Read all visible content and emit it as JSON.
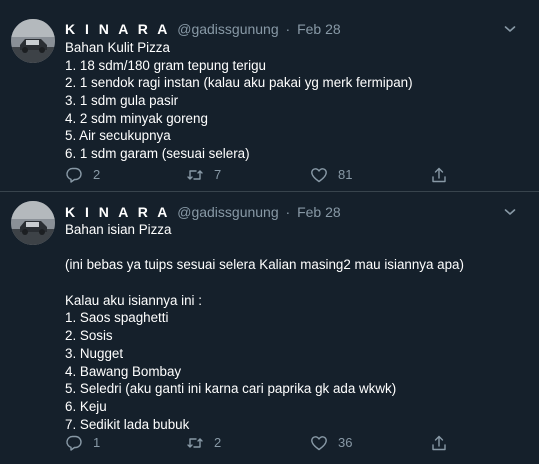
{
  "tweets": [
    {
      "display_name": "K I N A R A",
      "handle": "@gadissgunung",
      "separator": "·",
      "date": "Feb 28",
      "lines": [
        "Bahan Kulit Pizza",
        "1. 18 sdm/180 gram tepung terigu",
        "2. 1 sendok ragi instan (kalau aku pakai yg merk fermipan)",
        "3. 1 sdm gula pasir",
        "4. 2 sdm minyak goreng",
        "5. Air secukupnya",
        "6. 1 sdm garam (sesuai selera)"
      ],
      "reply_count": "2",
      "retweet_count": "7",
      "like_count": "81"
    },
    {
      "display_name": "K I N A R A",
      "handle": "@gadissgunung",
      "separator": "·",
      "date": "Feb 28",
      "lines": [
        "Bahan isian Pizza",
        "",
        "(ini bebas ya tuips sesuai selera Kalian masing2 mau isiannya apa)",
        "",
        "Kalau aku isiannya ini :",
        "1. Saos spaghetti",
        "2. Sosis",
        "3. Nugget",
        "4. Bawang Bombay",
        "5. Seledri (aku ganti ini karna cari paprika gk ada wkwk)",
        "6. Keju",
        "7. Sedikit lada bubuk"
      ],
      "reply_count": "1",
      "retweet_count": "2",
      "like_count": "36"
    }
  ],
  "icons": {
    "reply": "reply-icon",
    "retweet": "retweet-icon",
    "like": "heart-icon",
    "share": "share-icon",
    "caret": "chevron-down-icon"
  },
  "colors": {
    "background": "#15202b",
    "text": "#ffffff",
    "secondary": "#8899a6",
    "divider": "#38444d"
  }
}
